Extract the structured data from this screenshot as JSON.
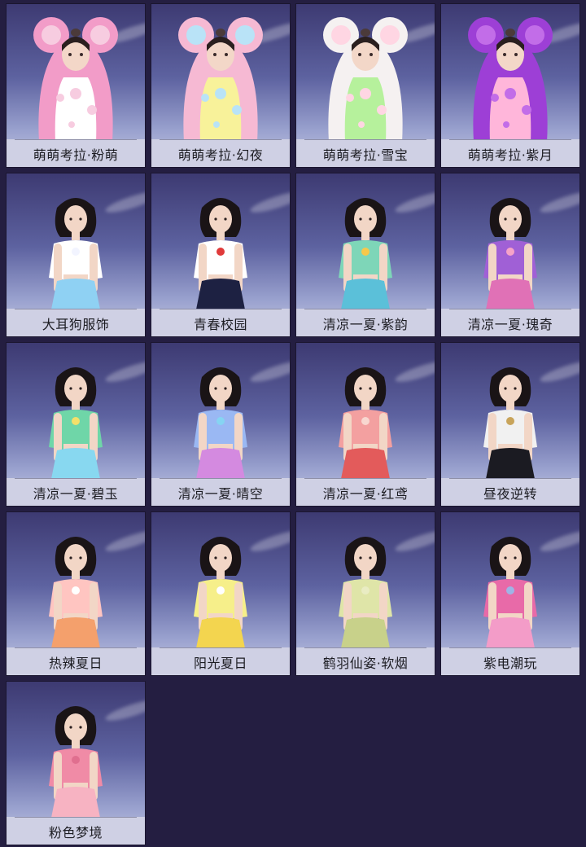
{
  "items": [
    {
      "label": "萌萌考拉·粉萌",
      "kind": "koala",
      "palette": [
        "#f29cc8",
        "#f7cce0",
        "#ffffff"
      ]
    },
    {
      "label": "萌萌考拉·幻夜",
      "kind": "koala",
      "palette": [
        "#f6b9d3",
        "#b9e3f7",
        "#f8f29a"
      ]
    },
    {
      "label": "萌萌考拉·雪宝",
      "kind": "koala",
      "palette": [
        "#f5f1f1",
        "#ffd6e3",
        "#b6f19c"
      ]
    },
    {
      "label": "萌萌考拉·紫月",
      "kind": "koala",
      "palette": [
        "#9d3fd6",
        "#c26de8",
        "#ffb6da"
      ]
    },
    {
      "label": "大耳狗服饰",
      "kind": "girl",
      "palette": [
        "#ffffff",
        "#8fd1f3",
        "#f2f4ff"
      ]
    },
    {
      "label": "青春校园",
      "kind": "girl",
      "palette": [
        "#ffffff",
        "#1d2142",
        "#e03a3a"
      ]
    },
    {
      "label": "清凉一夏·紫韵",
      "kind": "girl",
      "palette": [
        "#7ed6b8",
        "#5bc0d9",
        "#f7c84b"
      ]
    },
    {
      "label": "清凉一夏·瑰奇",
      "kind": "girl",
      "palette": [
        "#a060d6",
        "#e071b6",
        "#f6a3c8"
      ]
    },
    {
      "label": "清凉一夏·碧玉",
      "kind": "girl",
      "palette": [
        "#6fd6a8",
        "#88d8f0",
        "#f3e06a"
      ]
    },
    {
      "label": "清凉一夏·晴空",
      "kind": "girl",
      "palette": [
        "#9ab8f3",
        "#d48ae0",
        "#86d4f2"
      ]
    },
    {
      "label": "清凉一夏·红鸢",
      "kind": "girl",
      "palette": [
        "#f3a0a0",
        "#e35b5b",
        "#f8d7d0"
      ]
    },
    {
      "label": "昼夜逆转",
      "kind": "girl",
      "palette": [
        "#f1f1f1",
        "#1b1b22",
        "#c8a45a"
      ]
    },
    {
      "label": "热辣夏日",
      "kind": "girl",
      "palette": [
        "#ffc5c1",
        "#f4a06c",
        "#ffffff"
      ]
    },
    {
      "label": "阳光夏日",
      "kind": "girl",
      "palette": [
        "#f6ef8a",
        "#f3d54f",
        "#ffffff"
      ]
    },
    {
      "label": "鹤羽仙姿·软烟",
      "kind": "girl",
      "palette": [
        "#dfe5a8",
        "#c8d18a",
        "#e9ecc3"
      ]
    },
    {
      "label": "紫电潮玩",
      "kind": "girl",
      "palette": [
        "#e86aa8",
        "#f39cc8",
        "#9fb4e6"
      ]
    },
    {
      "label": "粉色梦境",
      "kind": "girl",
      "palette": [
        "#f08ba6",
        "#f7b3c2",
        "#e06f8f"
      ]
    }
  ]
}
